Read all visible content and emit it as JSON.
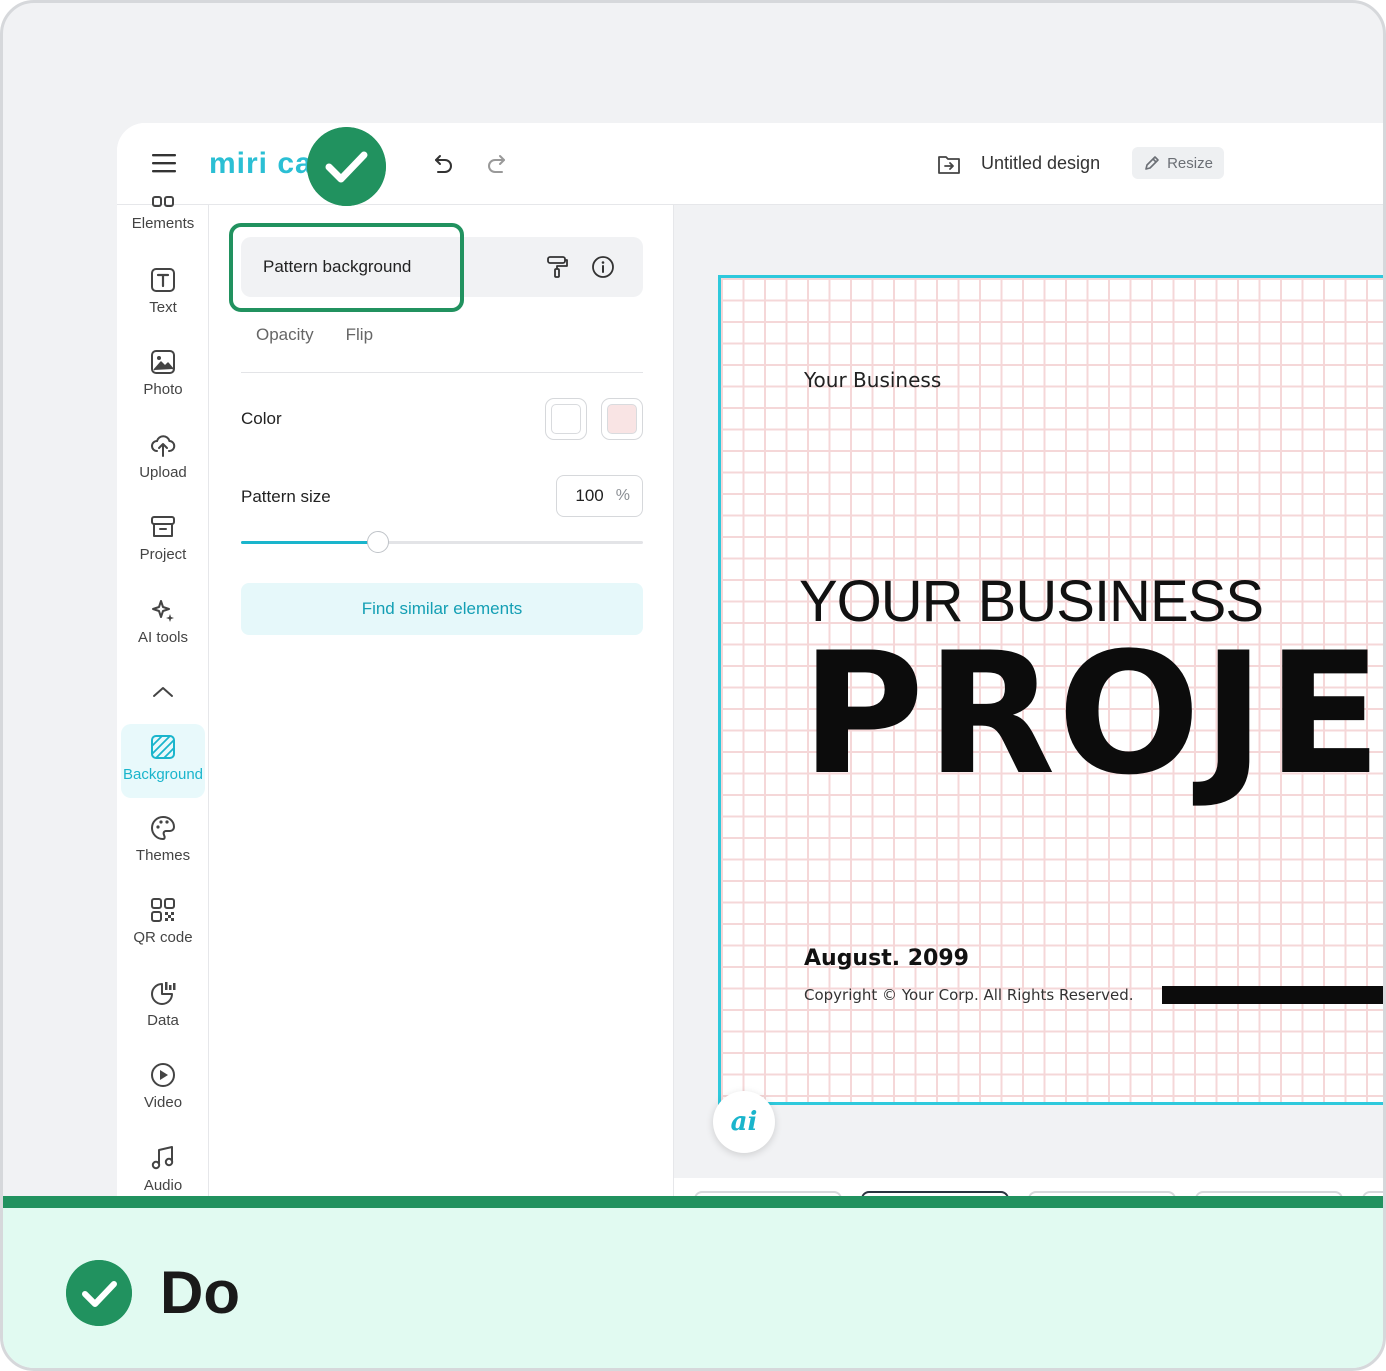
{
  "app": {
    "logo_text": "miri ca",
    "document_title": "Untitled design",
    "resize_label": "Resize"
  },
  "sidebar": {
    "items": [
      {
        "label": "Elements",
        "icon": "elements-icon"
      },
      {
        "label": "Text",
        "icon": "text-icon"
      },
      {
        "label": "Photo",
        "icon": "photo-icon"
      },
      {
        "label": "Upload",
        "icon": "upload-icon"
      },
      {
        "label": "Project",
        "icon": "project-icon"
      },
      {
        "label": "AI tools",
        "icon": "ai-tools-icon"
      },
      {
        "label": "Background",
        "icon": "background-icon",
        "active": true
      },
      {
        "label": "Themes",
        "icon": "themes-icon"
      },
      {
        "label": "QR code",
        "icon": "qr-code-icon"
      },
      {
        "label": "Data",
        "icon": "data-icon"
      },
      {
        "label": "Video",
        "icon": "video-icon"
      },
      {
        "label": "Audio",
        "icon": "audio-icon"
      }
    ]
  },
  "panel": {
    "section_title": "Pattern background",
    "tabs": [
      "Opacity",
      "Flip"
    ],
    "color_label": "Color",
    "color_swatches": [
      "#ffffff",
      "#f9e4e4"
    ],
    "pattern_size_label": "Pattern size",
    "pattern_size_value": "100",
    "pattern_size_unit": "%",
    "pattern_size_slider_fraction": 0.34,
    "find_similar_label": "Find similar elements"
  },
  "canvas": {
    "small_heading": "Your Business",
    "title": "YOUR BUSINESS",
    "big_text": "PROJEC",
    "date": "August. 2099",
    "copyright": "Copyright © Your Corp. All Rights Reserved.",
    "ai_button": "ai",
    "grid_color": "#f5d7d8",
    "border_color": "#2ec9dc"
  },
  "footer": {
    "label": "Do",
    "accent_color": "#21925f"
  }
}
